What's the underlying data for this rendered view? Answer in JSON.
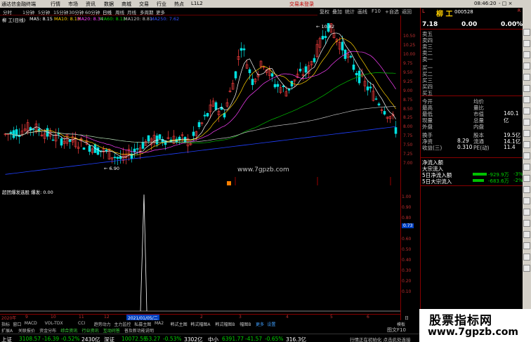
{
  "menubar": {
    "app": "通达信金融终端",
    "items": [
      "行情",
      "市场",
      "资讯",
      "数据",
      "商城",
      "交易",
      "行业",
      "热点",
      "L1L2"
    ],
    "login": "交易未登录",
    "right": "-  □  ×"
  },
  "toolbar": {
    "items": [
      "分时",
      "1分钟",
      "5分钟",
      "15分钟",
      "30分钟",
      "60分钟",
      "日线",
      "周线",
      "月线",
      "多周期",
      "更多"
    ],
    "right": [
      "复权",
      "叠加",
      "统计",
      "画线",
      "F10",
      "+自选",
      "返回"
    ]
  },
  "stock": {
    "name": "柳 工",
    "code": "000528",
    "flag": "R",
    "price": "7.18",
    "change": "0.00",
    "pct": "0.00%"
  },
  "chart": {
    "header": "柳 工(日线)",
    "ma": [
      "MA5: 8.15",
      "MA10: 8.13",
      "MA20: 8.34",
      "MA60: 8.13",
      "MA120: 8.81",
      "MA250: 7.62"
    ],
    "high_label": "10.82",
    "low_label": "6.90",
    "site": "www.7gpzb.com",
    "yticks": [
      "10.50",
      "10.25",
      "10.00",
      "9.75",
      "9.50",
      "9.25",
      "9.00",
      "8.75",
      "8.50",
      "8.25",
      "8.00",
      "7.75",
      "7.50",
      "7.25",
      "7.00"
    ]
  },
  "indicator": {
    "header": "超团爆发选股  爆发: 0.00",
    "yticks": [
      "1.00",
      "0.90",
      "0.80",
      "0.73",
      "0.60",
      "0.50",
      "0.40",
      "0.30",
      "0.20",
      "0.10"
    ],
    "marker": "0.73"
  },
  "timeline": {
    "labels": [
      "2020年",
      "9",
      "10",
      "11",
      "12",
      "2021/01/05/二",
      "2",
      "3",
      "4",
      "5",
      "6"
    ],
    "right": "日线"
  },
  "tabs1": [
    "指标",
    "窗口",
    "MACD",
    "VOL-TDX",
    "CCI",
    "趋势动力",
    "主力监控",
    "私募主图",
    "MA2",
    "韩式主图",
    "韩式幅图A",
    "韩式幅图B",
    "幅图B",
    "更多",
    "设置"
  ],
  "tabs2": [
    "扩展A",
    "关联报价",
    "资金分布",
    "综合资讯",
    "行业资讯",
    "互动问答",
    "普及新功能说明"
  ],
  "tabs_right": "模板",
  "orderbook": {
    "sell": [
      "卖五",
      "卖四",
      "卖三",
      "卖二",
      "卖一"
    ],
    "buy": [
      "买一",
      "买二",
      "买三",
      "买四",
      "买五"
    ]
  },
  "stats": [
    [
      "今开",
      "",
      "均价",
      ""
    ],
    [
      "最高",
      "",
      "量比",
      ""
    ],
    [
      "最低",
      "",
      "市值",
      "140.1亿"
    ],
    [
      "现量",
      "",
      "总量",
      ""
    ],
    [
      "外盘",
      "",
      "内盘",
      ""
    ],
    [
      "换手",
      "",
      "股本",
      "19.5亿"
    ],
    [
      "净资",
      "8.29",
      "流通",
      "14.1亿"
    ],
    [
      "收益(三)",
      "0.310",
      "PE(动)",
      "11.4"
    ]
  ],
  "flows": [
    [
      "净流入额",
      "",
      ""
    ],
    [
      "大宗流入",
      "",
      ""
    ],
    [
      "5日净流入额",
      "-929.9万",
      "-3%"
    ],
    [
      "5日大宗流入",
      "-683.6万",
      "-2%"
    ]
  ],
  "bottom_right": [
    "图文F10",
    "供流",
    "扩"
  ],
  "statusbar": [
    [
      "上证",
      "3108.57",
      "-16.39",
      "-0.52%",
      "2430亿"
    ],
    [
      "深证",
      "10072.55",
      "-53.27",
      "-0.53%",
      "3302亿"
    ],
    [
      "中小",
      "6391.77",
      "-41.57",
      "-0.65%",
      "316.3亿"
    ]
  ],
  "status_msg": "行情正在初始化 点击此处连接",
  "clock": "08:46:20",
  "watermark": {
    "title": "股票指标网",
    "url": "www.7gpzb.com"
  },
  "colors": {
    "up": "#ff4040",
    "down": "#00e0e0",
    "ma5": "#ffffff",
    "ma10": "#ffd000",
    "ma20": "#ff40ff",
    "ma60": "#00c000",
    "ma120": "#c0c0c0",
    "ma250": "#2040ff"
  }
}
